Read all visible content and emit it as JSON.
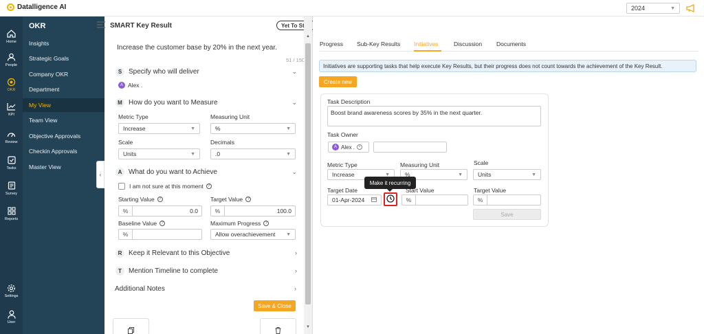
{
  "app": {
    "brand": "Datalligence AI",
    "year": "2024"
  },
  "rail": [
    {
      "label": "Home",
      "icon": "home-icon"
    },
    {
      "label": "People",
      "icon": "people-icon"
    },
    {
      "label": "OKR",
      "icon": "okr-target-icon"
    },
    {
      "label": "KPI",
      "icon": "kpi-chart-icon"
    },
    {
      "label": "Review",
      "icon": "review-gauge-icon"
    },
    {
      "label": "Tasks",
      "icon": "tasks-check-icon"
    },
    {
      "label": "Survey",
      "icon": "survey-icon"
    },
    {
      "label": "Reports",
      "icon": "reports-icon"
    },
    {
      "label": "Settings",
      "icon": "settings-gear-icon"
    },
    {
      "label": "User",
      "icon": "user-icon"
    }
  ],
  "subnav": {
    "title": "OKR",
    "items": [
      "Insights",
      "Strategic Goals",
      "Company OKR",
      "Department",
      "My View",
      "Team View",
      "Objective Approvals",
      "Checkin Approvals",
      "Master View"
    ],
    "active": "My View"
  },
  "left": {
    "header": "SMART Key Result",
    "status": "Yet To Start",
    "kr_title": "Increase the customer base by 20% in the next year.",
    "counter": "51 / 150",
    "specify": {
      "badge": "S",
      "label": "Specify who will deliver",
      "owner_initial": "A",
      "owner_name": "Alex ."
    },
    "measure": {
      "badge": "M",
      "label": "How do you want to Measure",
      "metric_type_label": "Metric Type",
      "metric_type": "Increase",
      "unit_label": "Measuring Unit",
      "unit": "%",
      "scale_label": "Scale",
      "scale": "Units",
      "decimals_label": "Decimals",
      "decimals": ".0"
    },
    "achieve": {
      "badge": "A",
      "label": "What do you want to Achieve",
      "not_sure": "I am not sure at this moment",
      "start_label": "Starting Value",
      "start_unit": "%",
      "start_value": "0.0",
      "target_label": "Target Value",
      "target_unit": "%",
      "target_value": "100.0",
      "baseline_label": "Baseline Value",
      "baseline_unit": "%",
      "maxprog_label": "Maximum Progress",
      "maxprog": "Allow overachievement"
    },
    "relevant": {
      "badge": "R",
      "label": "Keep it Relevant to this Objective"
    },
    "timeline": {
      "badge": "T",
      "label": "Mention Timeline to complete"
    },
    "notes": "Additional Notes",
    "save_close": "Save & Close"
  },
  "right": {
    "tabs": [
      "Progress",
      "Sub-Key Results",
      "Initiatives",
      "Discussion",
      "Documents"
    ],
    "active_tab": "Initiatives",
    "info": "Initiatives are supporting tasks that help execute Key Results, but their progress does not count towards the achievement of the Key Result.",
    "create_new": "Create new",
    "task": {
      "desc_label": "Task Description",
      "desc": "Boost brand awareness scores by 35% in the next quarter.",
      "owner_label": "Task Owner",
      "owner_initial": "A",
      "owner_name": "Alex .",
      "metric_type_label": "Metric Type",
      "metric_type": "Increase",
      "unit_label": "Measuring Unit",
      "unit": "%",
      "scale_label": "Scale",
      "scale": "Units",
      "target_date_label": "Target Date",
      "target_date": "01-Apr-2024",
      "start_label": "Start Value",
      "start_unit": "%",
      "target_label": "Target Value",
      "target_unit": "%",
      "tooltip": "Make it recurring",
      "save": "Save"
    }
  }
}
